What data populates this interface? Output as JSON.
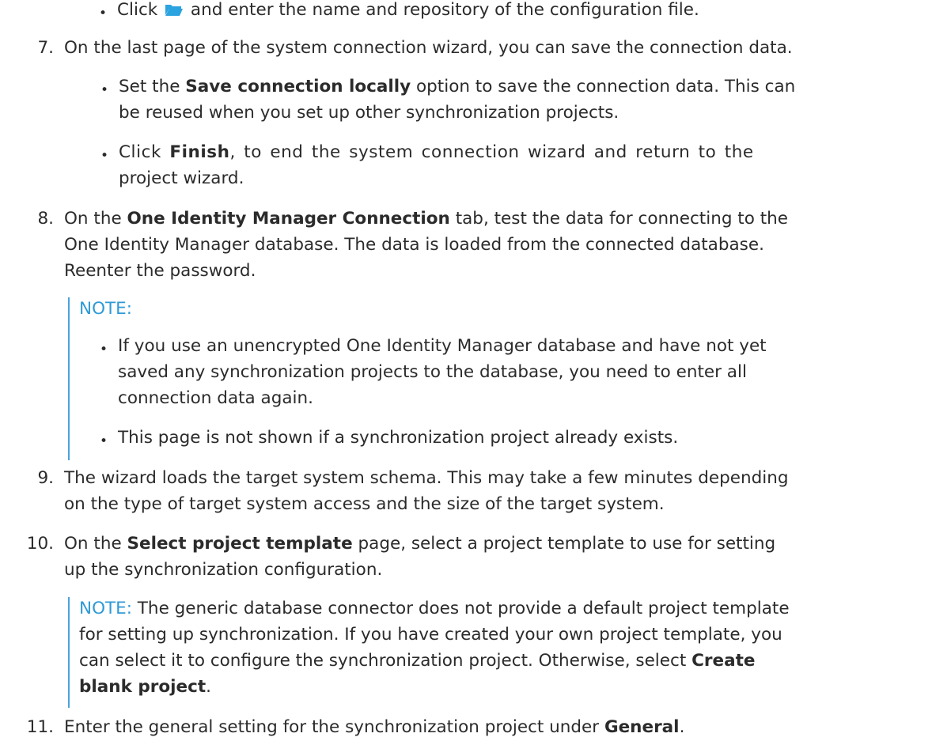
{
  "step6_bullet": {
    "before": "Click",
    "icon": "folder-open-icon",
    "after": " and enter the name and repository of the configuration file."
  },
  "step7": {
    "number": "7.",
    "text": "On the last page of the system connection wizard, you can save the connection data.",
    "bullet1": {
      "pre": "Set the ",
      "bold": "Save connection locally",
      "post": " option to save the connection data. This can",
      "line2": "be reused when you set up other synchronization projects."
    },
    "bullet2": {
      "pre": "Click ",
      "bold": "Finish",
      "post": ", to end the system connection wizard and return to the",
      "line2": "project wizard."
    }
  },
  "step8": {
    "number": "8.",
    "pre": "On the ",
    "bold": "One Identity Manager Connection",
    "post": " tab, test the data for connecting to the",
    "line2": "One Identity Manager database. The data is loaded from the connected database.",
    "line3": "Reenter the password.",
    "note_label": "NOTE:",
    "note_bullet1": [
      "If you use an unencrypted One Identity Manager database and have not yet",
      "saved any synchronization projects to the database, you need to enter all",
      "connection data again."
    ],
    "note_bullet2": "This page is not shown if a synchronization project already exists."
  },
  "step9": {
    "number": "9.",
    "line1": "The wizard loads the target system schema. This may take a few minutes depending",
    "line2": "on the type of target system access and the size of the target system."
  },
  "step10": {
    "number": "10.",
    "pre": "On the ",
    "bold": "Select project template",
    "post": " page, select a project template to use for setting",
    "line2": "up the synchronization configuration.",
    "note_label": "NOTE:",
    "note_line1": " The generic database connector does not provide a default project template",
    "note_line2": "for setting up synchronization. If you have created your own project template, you",
    "note_line3_pre": "can select it to configure the synchronization project. Otherwise, select ",
    "note_line3_bold": "Create",
    "note_line4_bold": "blank project",
    "note_line4_post": "."
  },
  "step11": {
    "number": "11.",
    "pre": "Enter the general setting for the synchronization project under ",
    "bold": "General",
    "post": "."
  },
  "colors": {
    "text": "#2b2b2b",
    "note_label": "#2f9ad6",
    "note_bar": "#4aa3df",
    "folder_icon": "#2aa3e0"
  }
}
